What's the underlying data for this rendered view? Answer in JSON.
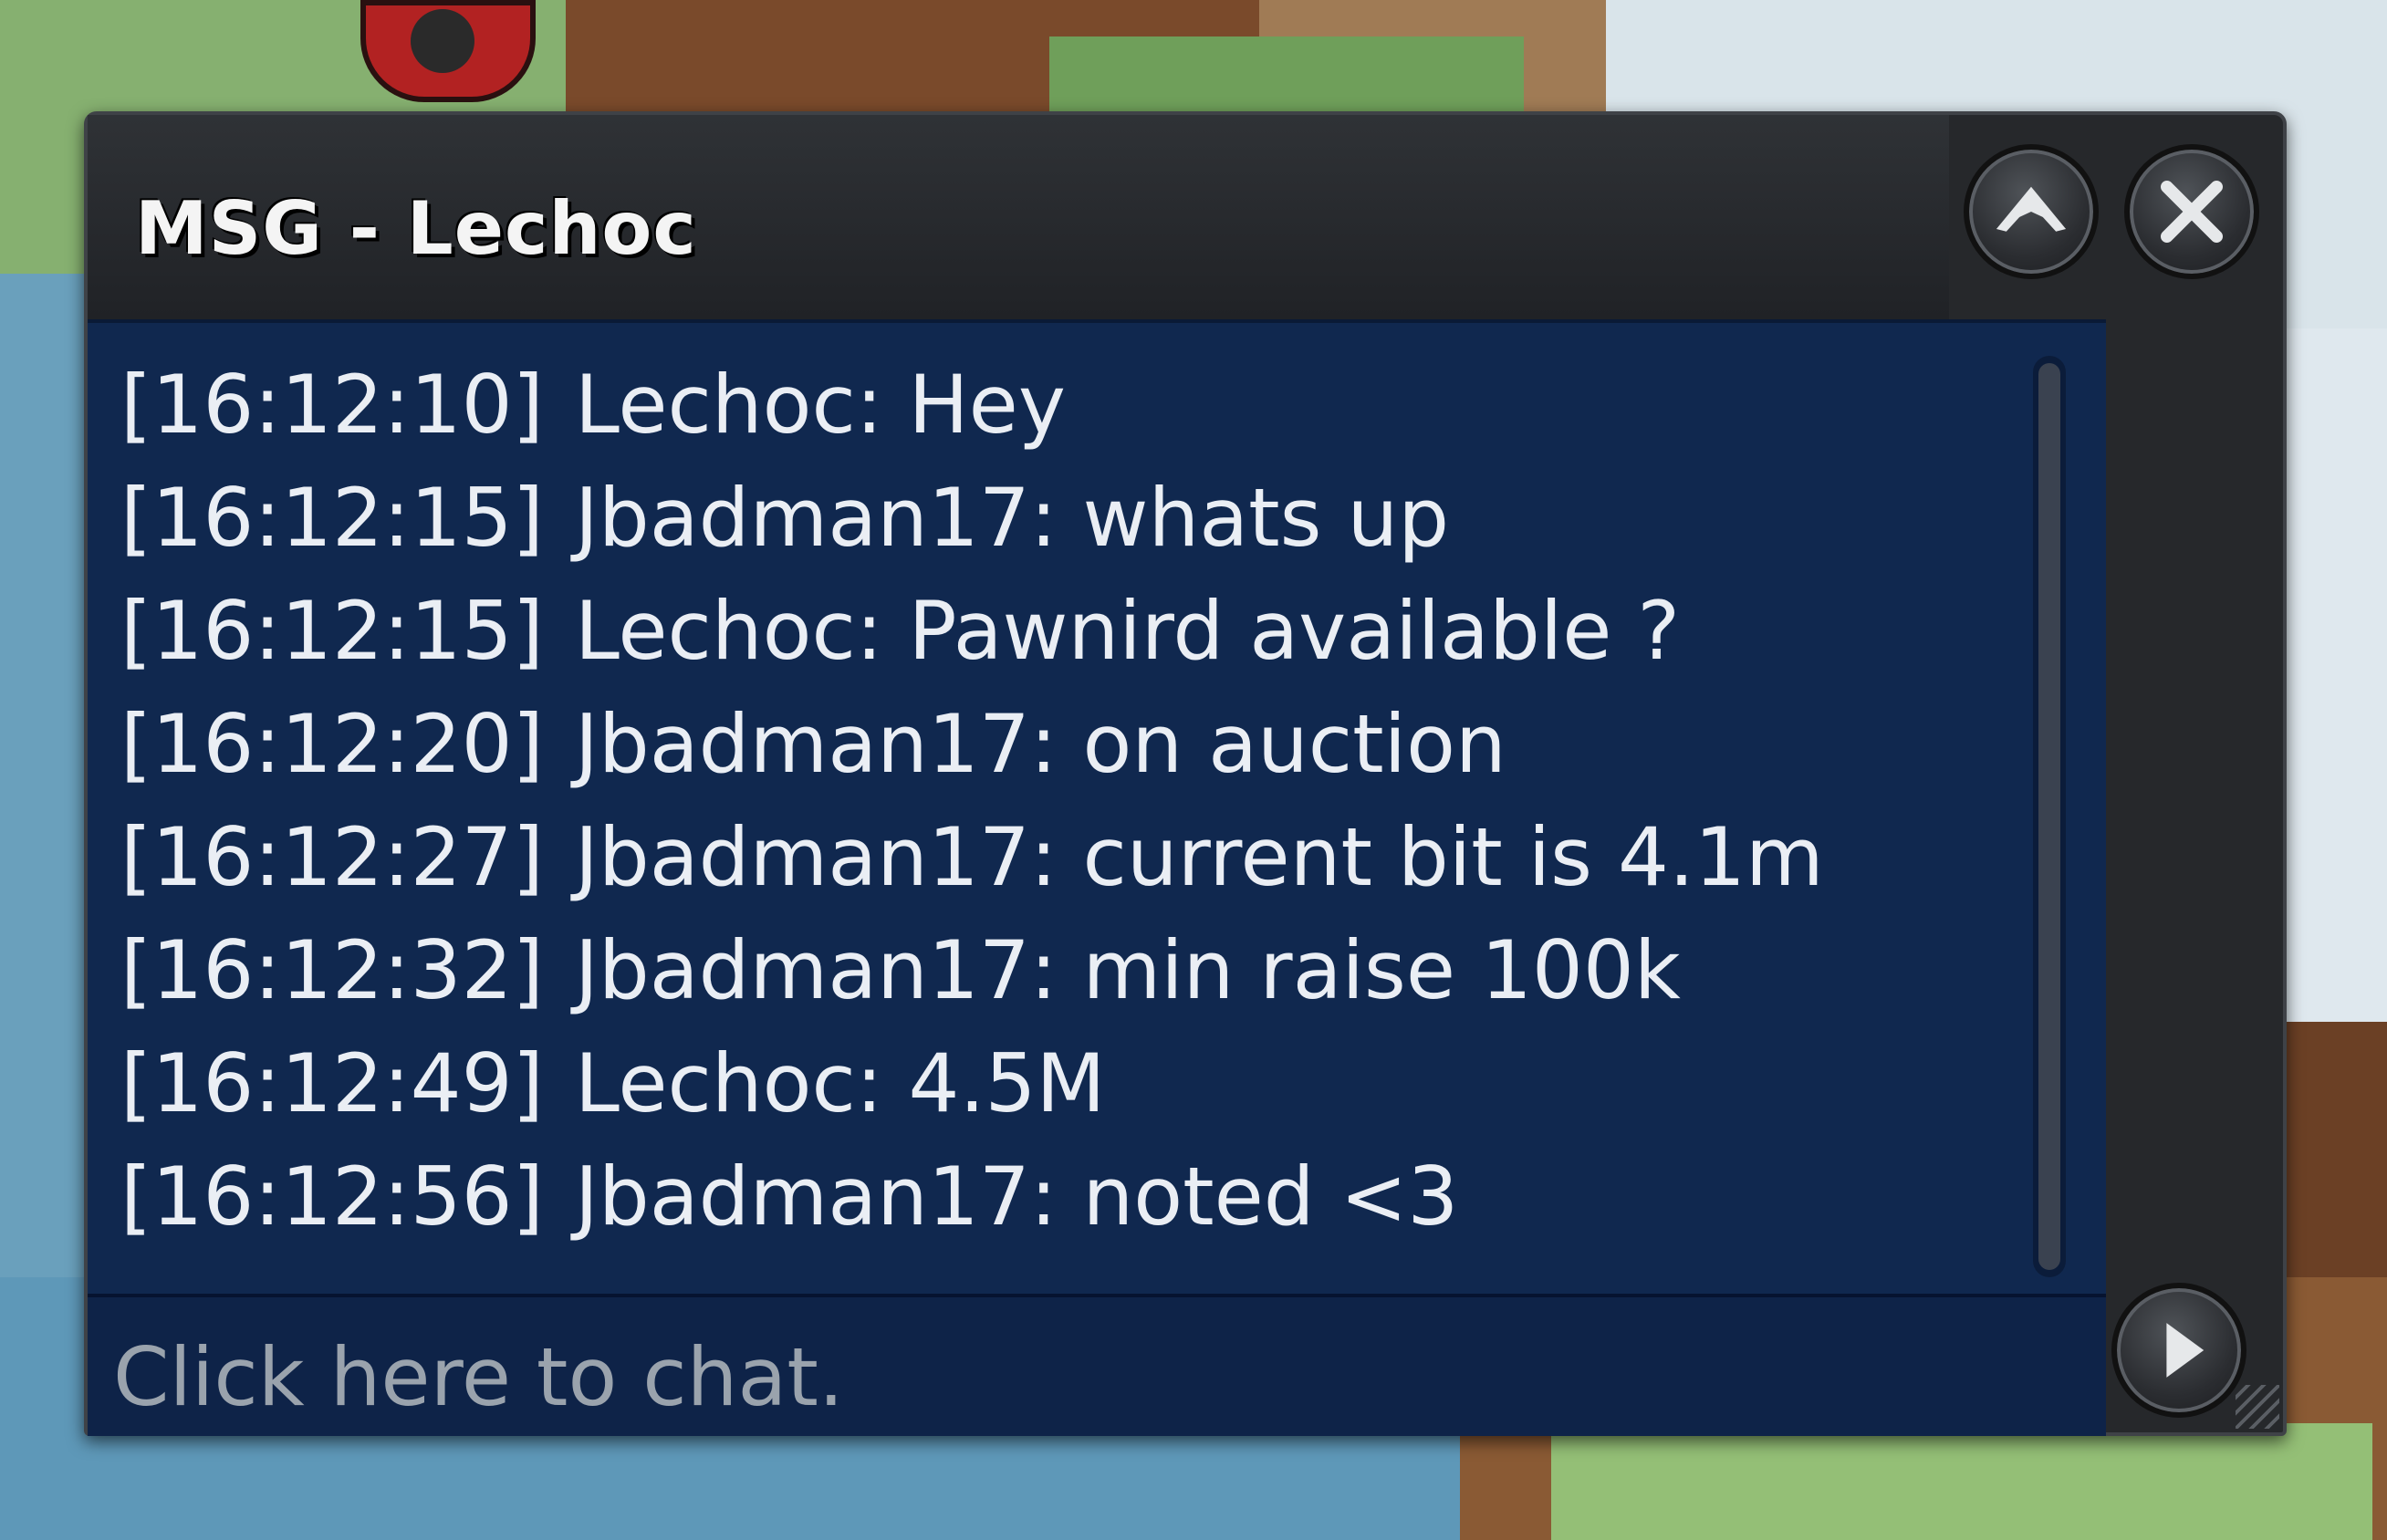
{
  "window": {
    "title": "MSG - Lechoc"
  },
  "messages": [
    {
      "time": "[16:12:10]",
      "text": "Lechoc: Hey"
    },
    {
      "time": "[16:12:15]",
      "text": "Jbadman17: whats up"
    },
    {
      "time": "[16:12:15]",
      "text": "Lechoc: Pawnird available ?"
    },
    {
      "time": "[16:12:20]",
      "text": "Jbadman17: on auction"
    },
    {
      "time": "[16:12:27]",
      "text": "Jbadman17: current bit is 4.1m"
    },
    {
      "time": "[16:12:32]",
      "text": "Jbadman17: min raise 100k"
    },
    {
      "time": "[16:12:49]",
      "text": "Lechoc: 4.5M"
    },
    {
      "time": "[16:12:56]",
      "text": "Jbadman17: noted <3"
    }
  ],
  "input": {
    "placeholder": "Click here to chat."
  },
  "icons": {
    "minimize": "chevron-up-icon",
    "close": "close-icon",
    "send": "play-arrow-icon"
  },
  "colors": {
    "log_background": "#10284f",
    "window_frame": "#26282b",
    "text": "#eaeef4",
    "placeholder": "#9aa3ad"
  }
}
